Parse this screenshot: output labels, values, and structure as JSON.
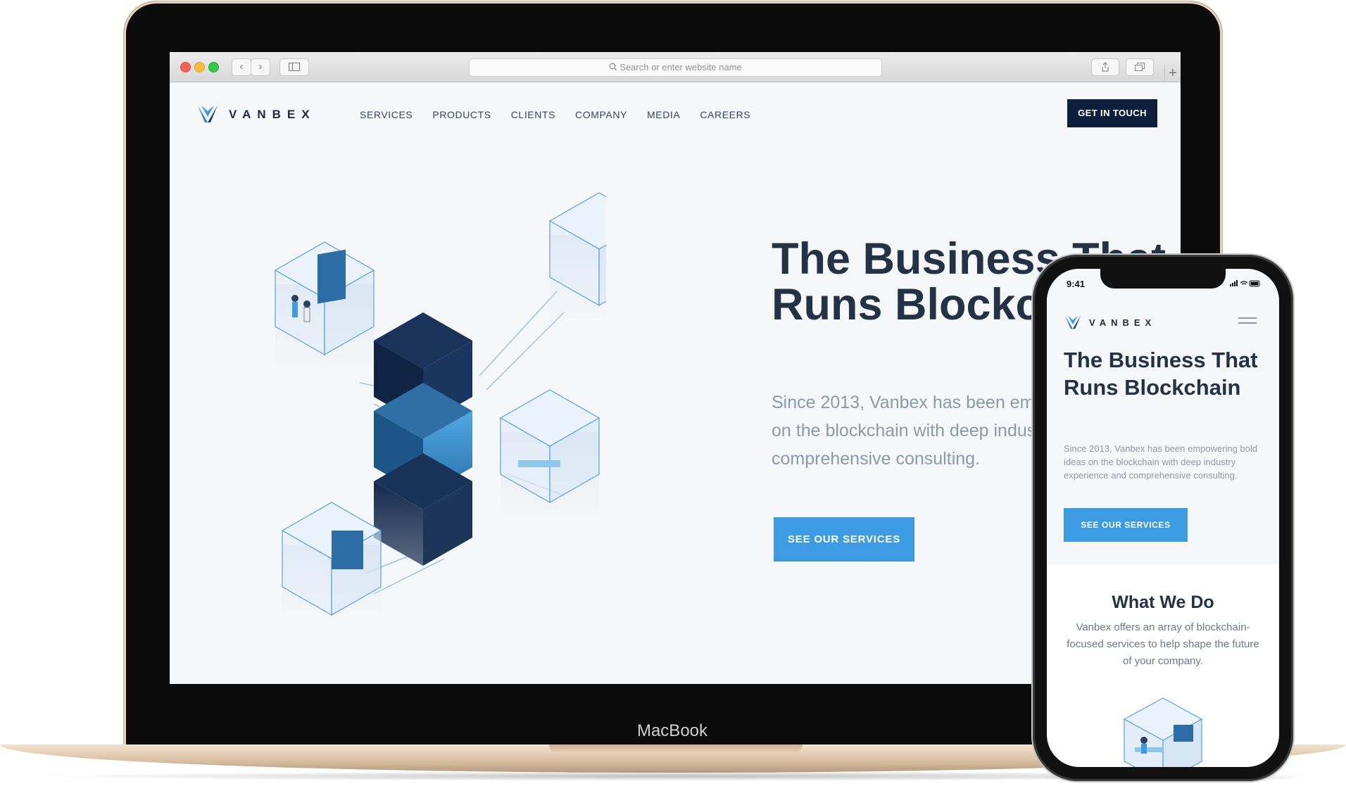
{
  "device": {
    "laptop_label": "MacBook"
  },
  "browser": {
    "url_placeholder": "Search or enter website name"
  },
  "site": {
    "brand": "VANBEX",
    "nav": [
      "SERVICES",
      "PRODUCTS",
      "CLIENTS",
      "COMPANY",
      "MEDIA",
      "CAREERS"
    ],
    "cta": "GET IN TOUCH",
    "hero_title": "The Business That Runs Blockchain",
    "hero_subtitle": "Since 2013, Vanbex has been empowering bold ideas on the blockchain with deep industry experience and comprehensive consulting.",
    "hero_button": "SEE OUR SERVICES"
  },
  "phone": {
    "time": "9:41",
    "brand": "VANBEX",
    "hero_title": "The Business That Runs Blockchain",
    "hero_subtitle": "Since 2013, Vanbex has been empowering bold ideas on the blockchain with deep industry experience and comprehensive consulting.",
    "hero_button": "SEE OUR SERVICES",
    "section_title": "What We Do",
    "section_text": "Vanbex offers an array of blockchain-focused services to help shape the future of your company."
  },
  "colors": {
    "brand_navy": "#0e1f3d",
    "accent_blue": "#3d9be3",
    "heading": "#243246",
    "body_text": "#8d99a8"
  }
}
